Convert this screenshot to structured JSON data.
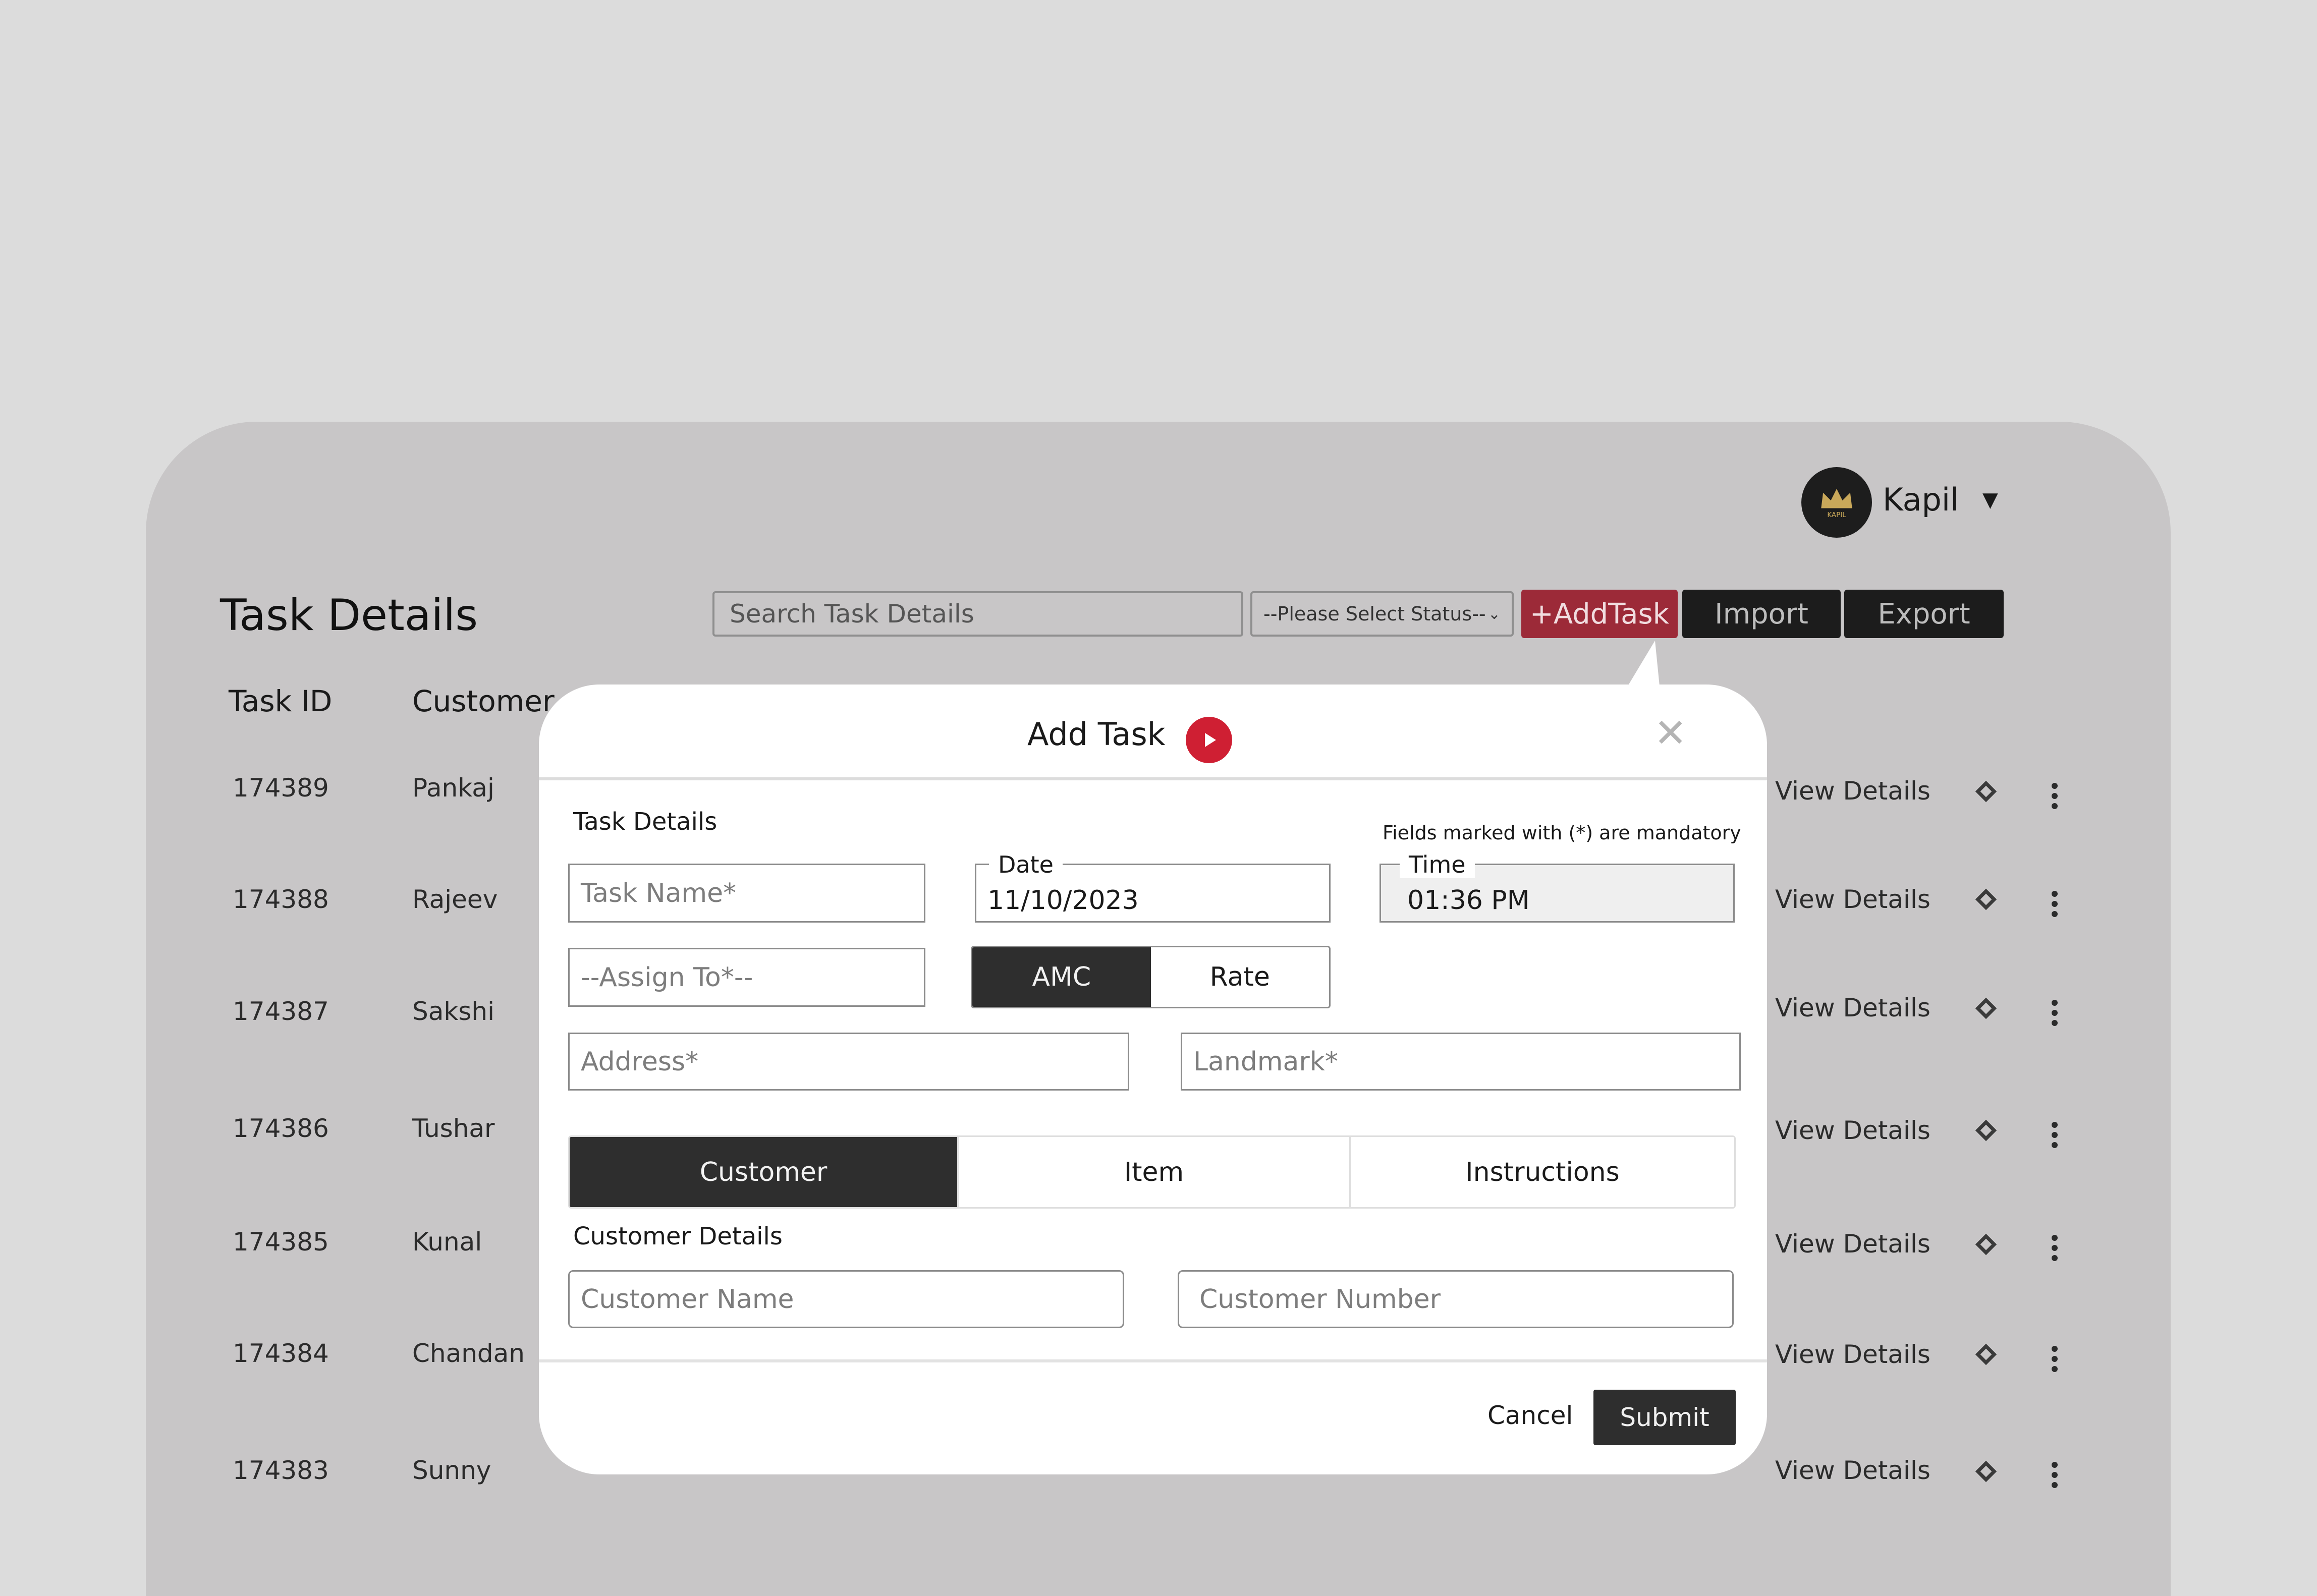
{
  "user": {
    "name": "Kapil",
    "avatar_text": "KAPIL"
  },
  "page": {
    "title": "Task Details"
  },
  "toolbar": {
    "search_placeholder": "Search Task Details",
    "status_select": "--Please Select Status--",
    "add_task": "+AddTask",
    "import": "Import",
    "export": "Export"
  },
  "table": {
    "headers": [
      "Task ID",
      "Customer"
    ],
    "rows": [
      {
        "id": "174389",
        "customer": "Pankaj",
        "action": "View Details"
      },
      {
        "id": "174388",
        "customer": "Rajeev",
        "action": "View Details"
      },
      {
        "id": "174387",
        "customer": "Sakshi",
        "action": "View Details"
      },
      {
        "id": "174386",
        "customer": "Tushar",
        "action": "View Details"
      },
      {
        "id": "174385",
        "customer": "Kunal",
        "action": "View Details"
      },
      {
        "id": "174384",
        "customer": "Chandan",
        "action": "View Details"
      },
      {
        "id": "174383",
        "customer": "Sunny",
        "action": "View Details"
      }
    ]
  },
  "modal": {
    "title": "Add Task",
    "section_task": "Task Details",
    "mandatory_note": "Fields marked with (*) are mandatory",
    "task_name_placeholder": "Task Name*",
    "date_label": "Date",
    "date_value": "11/10/2023",
    "time_label": "Time",
    "time_value": "01:36 PM",
    "assign_placeholder": "--Assign To*--",
    "type_options": [
      "AMC",
      "Rate"
    ],
    "address_placeholder": "Address*",
    "landmark_placeholder": "Landmark*",
    "tabs": [
      "Customer",
      "Item",
      "Instructions"
    ],
    "section_customer": "Customer Details",
    "customer_name_placeholder": "Customer Name",
    "customer_number_placeholder": "Customer Number",
    "cancel": "Cancel",
    "submit": "Submit"
  },
  "colors": {
    "accent": "#cf1f33",
    "dark": "#2e2e2e"
  }
}
